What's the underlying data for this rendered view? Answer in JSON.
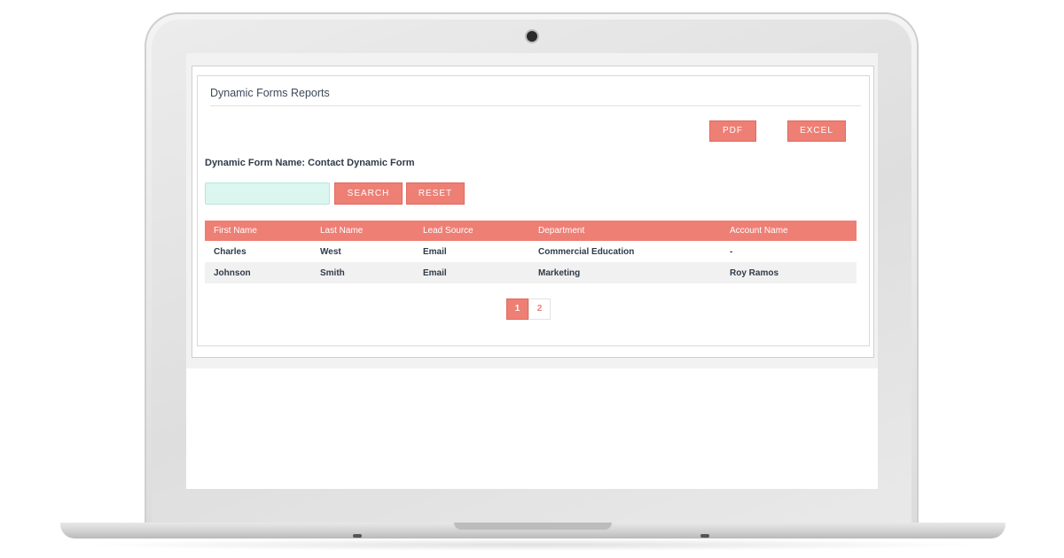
{
  "report": {
    "title": "Dynamic Forms Reports",
    "export": {
      "pdf_label": "PDF",
      "excel_label": "EXCEL"
    },
    "form_name_label": "Dynamic Form Name: Contact Dynamic Form",
    "search": {
      "value": "",
      "placeholder": "",
      "search_label": "SEARCH",
      "reset_label": "RESET"
    },
    "table": {
      "columns": [
        "First Name",
        "Last Name",
        "Lead Source",
        "Department",
        "Account Name"
      ],
      "rows": [
        [
          "Charles",
          "West",
          "Email",
          "Commercial Education",
          "-"
        ],
        [
          "Johnson",
          "Smith",
          "Email",
          "Marketing",
          "Roy Ramos"
        ]
      ]
    },
    "pagination": {
      "pages": [
        "1",
        "2"
      ],
      "current": "1"
    }
  },
  "colors": {
    "accent": "#ee7f75",
    "search_bg": "#dbf6ef",
    "text": "#2f3a48"
  }
}
